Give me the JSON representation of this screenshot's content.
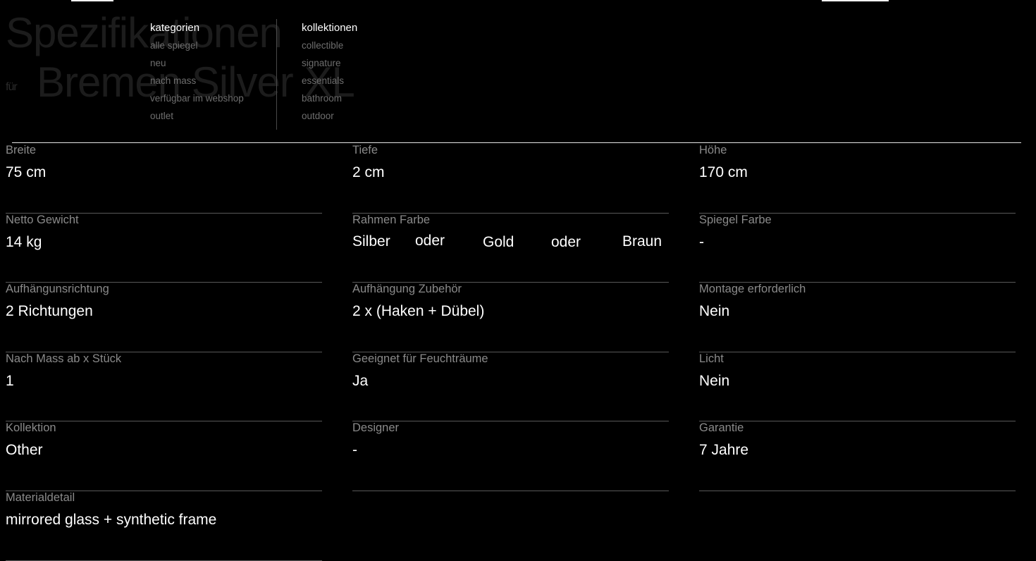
{
  "page": {
    "title_line1": "Spezifikationen",
    "title_for": "für",
    "title_line2": "Bremen Silver XL"
  },
  "menu": {
    "kategorien": {
      "heading": "kategorien",
      "items": [
        "alle spiegel",
        "neu",
        "nach mass",
        "verfügbar im webshop",
        "outlet"
      ]
    },
    "kollektionen": {
      "heading": "kollektionen",
      "items": [
        "collectible",
        "signature",
        "essentials",
        "bathroom",
        "outdoor"
      ]
    }
  },
  "specs": {
    "breite": {
      "label": "Breite",
      "value": "75 cm"
    },
    "tiefe": {
      "label": "Tiefe",
      "value": "2 cm"
    },
    "hoehe": {
      "label": "Höhe",
      "value": "170 cm"
    },
    "netto_gewicht": {
      "label": "Netto Gewicht",
      "value": "14 kg"
    },
    "rahmen_farbe": {
      "label": "Rahmen Farbe",
      "options": [
        "Silber",
        "Gold",
        "Braun"
      ],
      "separator": "oder"
    },
    "spiegel_farbe": {
      "label": "Spiegel Farbe",
      "value": "-"
    },
    "aufhaengungsrichtung": {
      "label": "Aufhängunsrichtung",
      "value": "2 Richtungen"
    },
    "aufhaengung_zubehoer": {
      "label": "Aufhängung Zubehör",
      "value": "2 x (Haken + Dübel)"
    },
    "montage": {
      "label": "Montage erforderlich",
      "value": "Nein"
    },
    "nach_mass": {
      "label": "Nach Mass ab x Stück",
      "value": "1"
    },
    "feuchtraeume": {
      "label": "Geeignet für Feuchträume",
      "value": "Ja"
    },
    "licht": {
      "label": "Licht",
      "value": "Nein"
    },
    "kollektion": {
      "label": "Kollektion",
      "value": "Other"
    },
    "designer": {
      "label": "Designer",
      "value": "-"
    },
    "garantie": {
      "label": "Garantie",
      "value": "7 Jahre"
    },
    "materialdetail": {
      "label": "Materialdetail",
      "value": "mirrored glass + synthetic frame"
    }
  },
  "colors": {
    "background": "#000000",
    "text": "#ffffff",
    "label": "#8a8a8a",
    "menu_item": "#6e6e6e",
    "divider": "#595959"
  }
}
